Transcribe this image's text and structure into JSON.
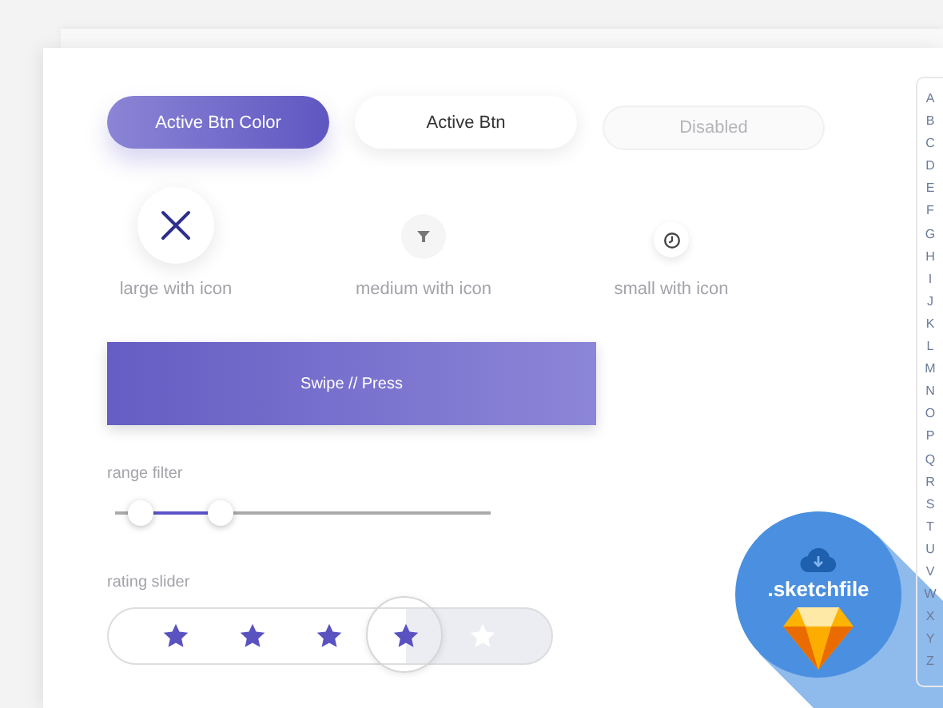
{
  "buttons": [
    {
      "label": "Active Btn Color",
      "kind": "filled"
    },
    {
      "label": "Active Btn",
      "kind": "outline"
    },
    {
      "label": "Disabled",
      "kind": "disabled"
    }
  ],
  "icon_buttons": [
    {
      "label": "large with icon",
      "kind": "large"
    },
    {
      "label": "medium with icon",
      "kind": "medium"
    },
    {
      "label": "small with icon",
      "kind": "small"
    }
  ],
  "swipe_button": {
    "label": "Swipe // Press"
  },
  "range_filter": {
    "label": "range filter",
    "thumbs": [
      {
        "level": 0.07
      },
      {
        "level": 0.28
      }
    ]
  },
  "rating_slider": {
    "label": "rating slider",
    "stars": 4
  },
  "index_letters": [
    "A",
    "B",
    "C",
    "D",
    "E",
    "F",
    "G",
    "H",
    "I",
    "J",
    "K",
    "L",
    "M",
    "N",
    "O",
    "P",
    "Q",
    "R",
    "S",
    "T",
    "U",
    "V",
    "W",
    "X",
    "Y",
    "Z"
  ],
  "badge": {
    "label": ".sketchfile"
  }
}
